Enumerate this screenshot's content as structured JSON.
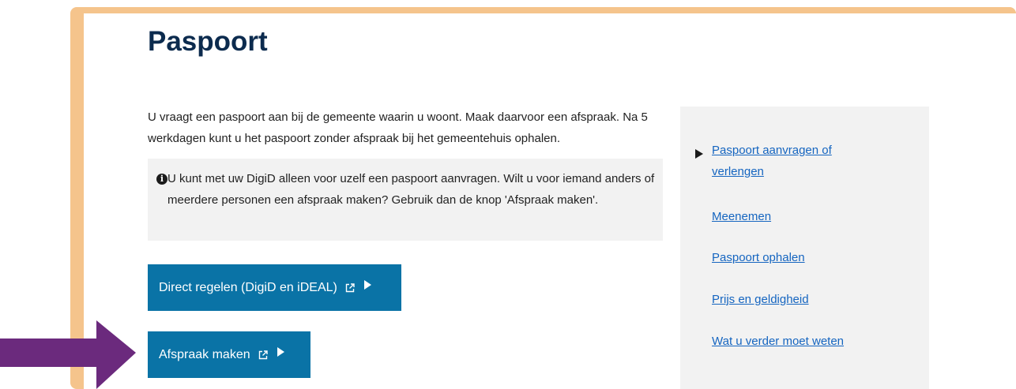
{
  "page": {
    "title": "Paspoort"
  },
  "intro": {
    "text": "U vraagt een paspoort aan bij de gemeente waarin u woont. Maak daarvoor een afspraak. Na 5 werkdagen kunt u het paspoort zonder afspraak bij het gemeentehuis ophalen."
  },
  "info": {
    "icon": "info-icon",
    "icon_glyph": "i",
    "text": "U kunt met uw DigiD alleen voor uzelf een paspoort aanvragen. Wilt u voor iemand anders of meerdere personen een afspraak maken? Gebruik dan de knop 'Afspraak maken'."
  },
  "buttons": [
    {
      "label": "Direct regelen (DigiD en iDEAL)",
      "icons": [
        "external-link-icon",
        "play-arrow-icon"
      ]
    },
    {
      "label": "Afspraak maken",
      "icons": [
        "external-link-icon",
        "play-arrow-icon"
      ]
    }
  ],
  "sidebar": {
    "items": [
      {
        "label": "Paspoort aanvragen of verlengen",
        "current": true
      },
      {
        "label": "Meenemen",
        "current": false
      },
      {
        "label": "Paspoort ophalen",
        "current": false
      },
      {
        "label": "Prijs en geldigheid",
        "current": false
      },
      {
        "label": "Wat u verder moet weten",
        "current": false
      }
    ]
  },
  "colors": {
    "frame": "#f5c48c",
    "title": "#0c2b4e",
    "button": "#0a73a6",
    "link": "#1565c0",
    "panel_bg": "#f2f2f2",
    "pointer_arrow": "#6b2a7d"
  }
}
